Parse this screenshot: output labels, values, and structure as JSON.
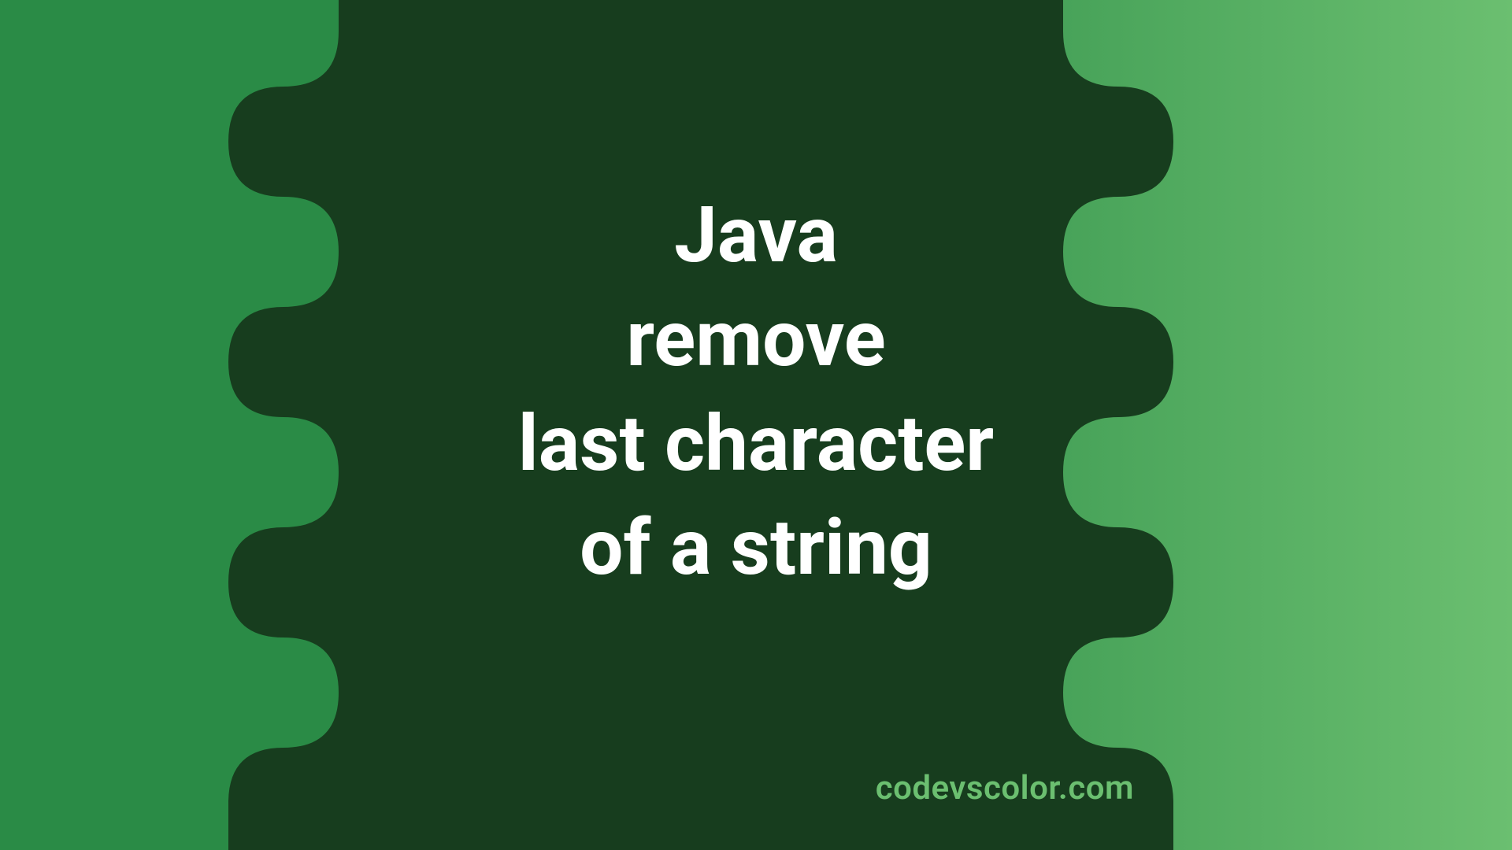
{
  "title_lines": "Java\nremove\nlast character\nof a string",
  "footer_text": "codevscolor.com",
  "colors": {
    "bg_left": "#2a8b46",
    "bg_right": "#6bbf70",
    "blob": "#173d1e",
    "title": "#ffffff",
    "footer": "#6bbf70"
  }
}
